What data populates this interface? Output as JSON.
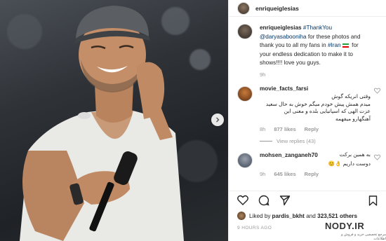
{
  "post": {
    "author": "enriqueiglesias",
    "caption": {
      "hashtag_thankyou": "#ThankYou",
      "mention": "@daryasabooniha",
      "text_1": " for these photos and thank you to all my fans in ",
      "hashtag_iran": "#Iran",
      "text_2": " for your endless dedication to make it to shows!!!! love you guys."
    },
    "caption_time": "9h"
  },
  "comments": [
    {
      "username": "movie_facts_farsi",
      "lines": [
        "وقتی انریکه گوش",
        "میدم همش پیش خودم میگم خوش به حال سعید",
        "عزت الهی که اسپانیایی بلده و معنی این",
        "آهنگهارو میفهمه"
      ],
      "time": "8h",
      "likes": "877 likes",
      "reply": "Reply",
      "view_replies": "View replies (43)"
    },
    {
      "username": "mohsen_zanganeh70",
      "lines": [
        "به همین برکت",
        "دوست داریم"
      ],
      "time": "9h",
      "likes": "645 likes",
      "reply": "Reply"
    }
  ],
  "likes_line": {
    "prefix": "Liked by ",
    "user": "pardis_bkht",
    "middle": " and ",
    "count": "323,521 others"
  },
  "posted_ago": "9 HOURS AGO",
  "watermark": {
    "text": "NODY.IR",
    "sub": "مرجع تخصصی خرید و فروش و اطلاعات"
  },
  "icons": {
    "heart": "heart-icon",
    "comment": "comment-icon",
    "share": "share-icon",
    "save": "bookmark-icon",
    "next": "chevron-right-icon"
  }
}
